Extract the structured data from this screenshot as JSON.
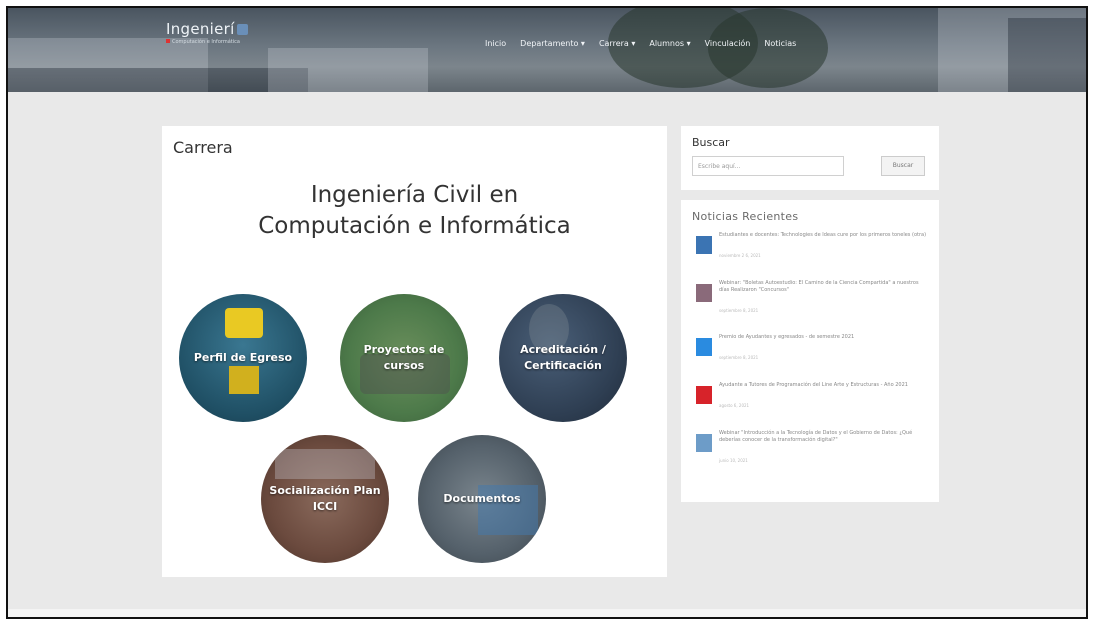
{
  "site": {
    "logo_text": "Ingenierí",
    "logo_tagline": "Computación e Informática"
  },
  "nav": {
    "items": [
      "Inicio",
      "Departamento ▾",
      "Carrera ▾",
      "Alumnos ▾",
      "Vinculación",
      "Noticias"
    ]
  },
  "main": {
    "breadcrumb": "Carrera",
    "title_line1": "Ingeniería Civil en",
    "title_line2": "Computación e Informática",
    "circles": [
      {
        "label": "Perfil de Egreso",
        "color": "#1f4f64"
      },
      {
        "label": "Proyectos de cursos",
        "color": "#4d7a4a"
      },
      {
        "label": "Acreditación / Certificación",
        "color": "#2e3e52"
      },
      {
        "label": "Socialización Plan ICCI",
        "color": "#6b4a3e"
      },
      {
        "label": "Documentos",
        "color": "#55616b"
      }
    ]
  },
  "sidebar": {
    "search": {
      "heading": "Buscar",
      "placeholder": "Escribe aquí...",
      "button_label": "Buscar"
    },
    "news": {
      "heading": "Noticias Recientes",
      "items": [
        {
          "title": "Estudiantes e docentes: Technologies de Ideas cure por los primeros toneles (otra)",
          "date": "noviembre 2 6, 2021",
          "thumb_color": "#3b74b3"
        },
        {
          "title": "Webinar: \"Boletas Autoestudio: El Camino de la Ciencia Compartida\" a nuestros días Realizaron \"Concursos\"",
          "date": "septiembre 8, 2021",
          "thumb_color": "#8a6a7a"
        },
        {
          "title": "Premio de Ayudantes y egresados - de semestre 2021",
          "date": "septiembre 8, 2021",
          "thumb_color": "#2a8be0"
        },
        {
          "title": "Ayudante a Tutores de Programación del Line Arte y Estructuras - Año 2021",
          "date": "agosto 6, 2021",
          "thumb_color": "#d7232a"
        },
        {
          "title": "Webinar \"Introducción a la Tecnología de Datos y el Gobierno de Datos: ¿Qué deberías conocer de la transformación digital?\"",
          "date": "junio 10, 2021",
          "thumb_color": "#6d9cc8"
        }
      ]
    }
  }
}
